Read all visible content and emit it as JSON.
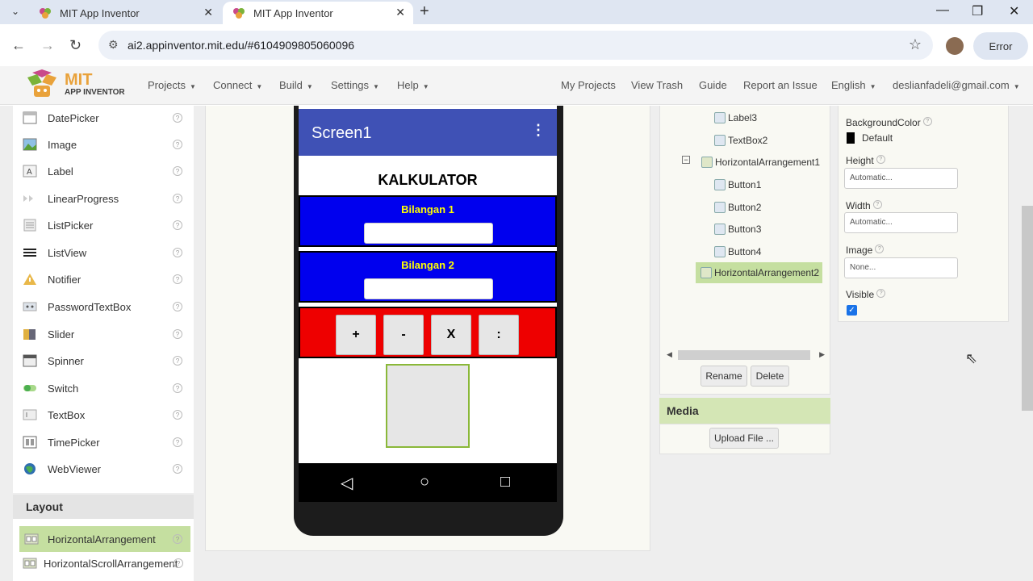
{
  "browser": {
    "tabs": [
      {
        "title": "MIT App Inventor",
        "active": false
      },
      {
        "title": "MIT App Inventor",
        "active": true
      }
    ],
    "url": "ai2.appinventor.mit.edu/#6104909805060096",
    "error_label": "Error",
    "icons": {
      "tab_list": "chevron-down",
      "new_tab": "+",
      "back": "←",
      "forward": "→",
      "reload": "↻",
      "site_info": "tune",
      "bookmark": "☆",
      "minimize": "—",
      "restore": "❐",
      "close": "✕"
    }
  },
  "app_header": {
    "logo_title": "MIT",
    "logo_subtitle": "APP INVENTOR",
    "menus": [
      "Projects",
      "Connect",
      "Build",
      "Settings",
      "Help"
    ],
    "links": [
      "My Projects",
      "View Trash",
      "Guide",
      "Report an Issue"
    ],
    "language": "English",
    "account": "deslianfadeli@gmail.com"
  },
  "palette": {
    "items": [
      {
        "label": "DatePicker",
        "icon": "datepicker-icon"
      },
      {
        "label": "Image",
        "icon": "image-icon"
      },
      {
        "label": "Label",
        "icon": "label-icon"
      },
      {
        "label": "LinearProgress",
        "icon": "linearprogress-icon"
      },
      {
        "label": "ListPicker",
        "icon": "listpicker-icon"
      },
      {
        "label": "ListView",
        "icon": "listview-icon"
      },
      {
        "label": "Notifier",
        "icon": "notifier-icon"
      },
      {
        "label": "PasswordTextBox",
        "icon": "passwordtextbox-icon"
      },
      {
        "label": "Slider",
        "icon": "slider-icon"
      },
      {
        "label": "Spinner",
        "icon": "spinner-icon"
      },
      {
        "label": "Switch",
        "icon": "switch-icon"
      },
      {
        "label": "TextBox",
        "icon": "textbox-icon"
      },
      {
        "label": "TimePicker",
        "icon": "timepicker-icon"
      },
      {
        "label": "WebViewer",
        "icon": "webviewer-icon"
      }
    ],
    "layout_header": "Layout",
    "layout_items": [
      {
        "label": "HorizontalArrangement",
        "selected": true
      },
      {
        "label": "HorizontalScrollArrangement",
        "selected": false
      }
    ],
    "help_glyph": "?"
  },
  "phone": {
    "screen_title": "Screen1",
    "menu_glyph": "⋮",
    "heading": "KALKULATOR",
    "input1_label": "Bilangan 1",
    "input2_label": "Bilangan 2",
    "buttons": [
      "+",
      "-",
      "X",
      ":"
    ],
    "nav": {
      "back": "◁",
      "home": "○",
      "recent": "□"
    }
  },
  "components": {
    "nodes": [
      {
        "label": "Label3",
        "level": 2,
        "selected": false
      },
      {
        "label": "TextBox2",
        "level": 2,
        "selected": false
      },
      {
        "label": "HorizontalArrangement1",
        "level": 1,
        "selected": false
      },
      {
        "label": "Button1",
        "level": 2,
        "selected": false
      },
      {
        "label": "Button2",
        "level": 2,
        "selected": false
      },
      {
        "label": "Button3",
        "level": 2,
        "selected": false
      },
      {
        "label": "Button4",
        "level": 2,
        "selected": false
      },
      {
        "label": "HorizontalArrangement2",
        "level": 1,
        "selected": true
      }
    ],
    "collapse_glyph": "⊟",
    "rename_label": "Rename",
    "delete_label": "Delete"
  },
  "media": {
    "header": "Media",
    "upload_label": "Upload File ..."
  },
  "properties": {
    "background_color_label": "BackgroundColor",
    "background_color_value": "Default",
    "height_label": "Height",
    "height_value": "Automatic...",
    "width_label": "Width",
    "width_value": "Automatic...",
    "image_label": "Image",
    "image_value": "None...",
    "visible_label": "Visible",
    "visible_checked": true
  },
  "colors": {
    "titlebar": "#3f51b5",
    "blue_arrangement": "#0000ee",
    "red_arrangement": "#ee0000",
    "caption_yellow": "#ffff00",
    "selection_green": "#c5dfa0",
    "media_header": "#d4e6b5",
    "logo_orange": "#e9a23b"
  }
}
